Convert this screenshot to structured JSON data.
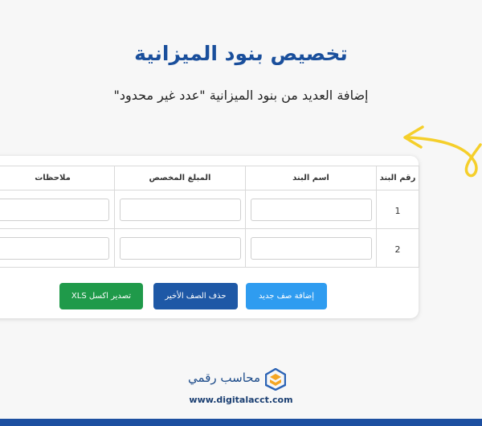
{
  "header": {
    "title": "تخصيص بنود الميزانية",
    "subtitle": "إضافة العديد من بنود الميزانية \"عدد غير محدود\""
  },
  "table": {
    "columns": [
      "رقم البند",
      "اسم البند",
      "المبلغ المخصص",
      "ملاحظات"
    ],
    "rows": [
      {
        "number": "1",
        "item_name": "",
        "amount": "",
        "notes": ""
      },
      {
        "number": "2",
        "item_name": "",
        "amount": "",
        "notes": ""
      }
    ]
  },
  "buttons": {
    "add_row": "إضافة صف جديد",
    "delete_last_row": "حذف الصف الأخير",
    "export_xls": "تصدير اكسل XLS"
  },
  "branding": {
    "logo_icon": "cube-logo-icon",
    "name": "محاسب رقمي",
    "website": "www.digitalacct.com"
  },
  "colors": {
    "title": "#1a4f9c",
    "arrow": "#f5cf2b",
    "add_button": "#2f9cf0",
    "delete_button": "#1e58a6",
    "export_button": "#1f9a4a",
    "bottom_bar": "#1d4fa0"
  }
}
